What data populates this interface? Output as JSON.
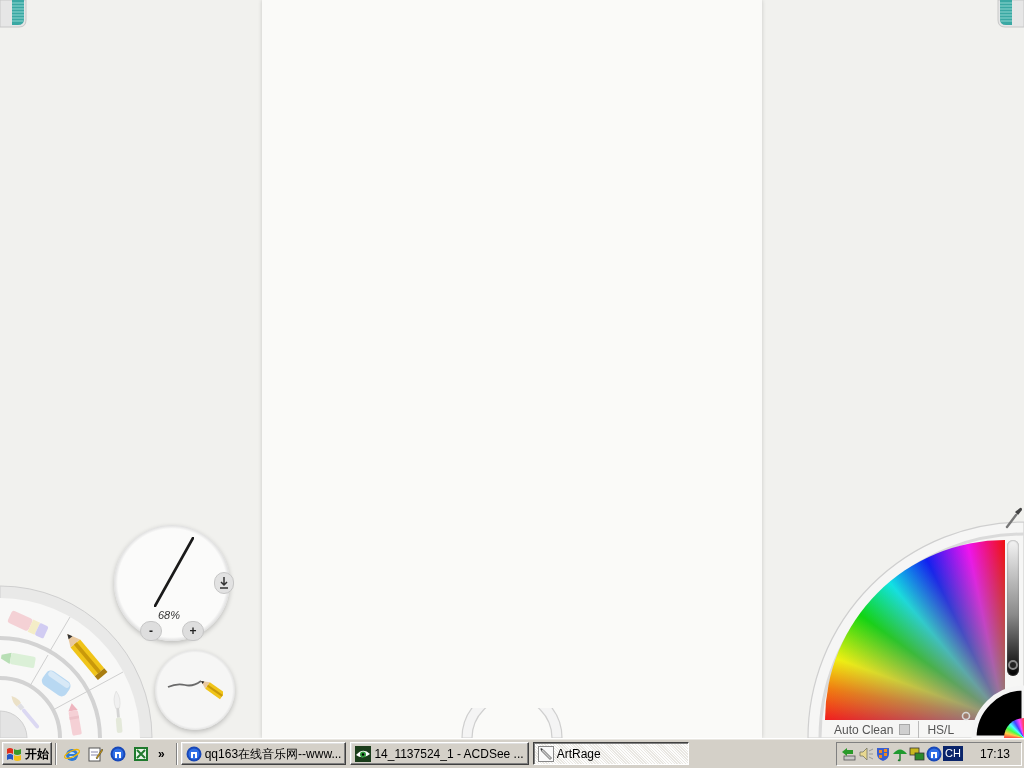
{
  "brush_size": {
    "reading": "68%",
    "decrease": "-",
    "increase": "+"
  },
  "tools": [
    {
      "kind": "eraser",
      "selected": false
    },
    {
      "kind": "pencil",
      "selected": true
    },
    {
      "kind": "knife",
      "selected": false
    },
    {
      "kind": "marker",
      "selected": false
    },
    {
      "kind": "tube",
      "selected": false
    },
    {
      "kind": "crayon",
      "selected": false
    },
    {
      "kind": "brush",
      "selected": false
    }
  ],
  "color_picker": {
    "auto_clean": {
      "label": "Auto Clean",
      "checked": false
    },
    "mode": "HS/L",
    "lightness": {
      "level": 0.03
    },
    "current_color": {
      "color": "#000000"
    }
  },
  "taskbar": {
    "start": "开始",
    "more": "»",
    "tasks": [
      {
        "kind": "circle",
        "label": "qq163在线音乐网--www...",
        "selected": false
      },
      {
        "kind": "eye",
        "label": "14_1137524_1 - ACDSee ...",
        "selected": false
      },
      {
        "kind": "pencil",
        "label": "ArtRage",
        "selected": true
      }
    ],
    "tray": {
      "language": "CH",
      "clock": "17:13"
    }
  }
}
